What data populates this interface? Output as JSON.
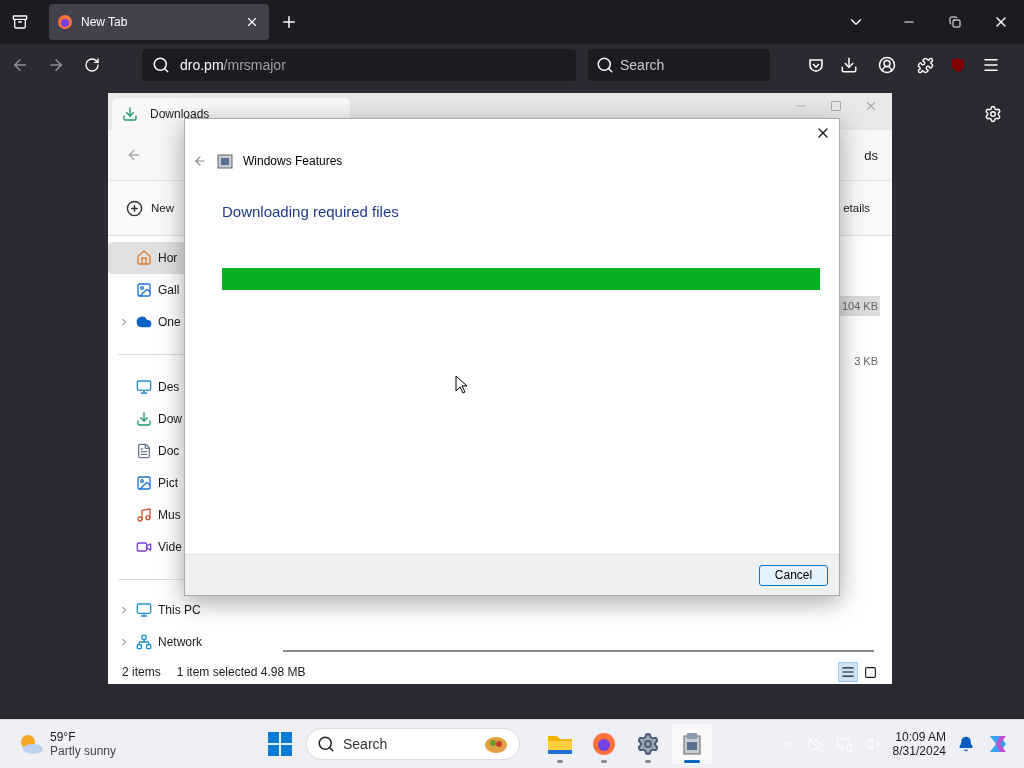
{
  "browser": {
    "tab": {
      "title": "New Tab"
    },
    "url": {
      "domain": "dro.pm",
      "path": "/mrsmajor"
    },
    "search": {
      "placeholder": "Search"
    }
  },
  "explorer": {
    "tab_title": "Downloads",
    "address_tail": "ds",
    "new_button": "New",
    "view_button": "etails",
    "nav_items": [
      {
        "label": "Hor",
        "selected": true
      },
      {
        "label": "Gall",
        "selected": false
      },
      {
        "label": "One",
        "selected": false
      }
    ],
    "library_items": [
      {
        "label": "Des",
        "selected": false
      },
      {
        "label": "Dow",
        "selected": false
      },
      {
        "label": "Doc",
        "selected": false
      },
      {
        "label": "Pict",
        "selected": false
      },
      {
        "label": "Mus",
        "selected": false
      },
      {
        "label": "Vide",
        "selected": false
      }
    ],
    "device_items": [
      {
        "label": "This PC"
      },
      {
        "label": "Network"
      }
    ],
    "sizes": [
      {
        "text": "104 KB",
        "selected": true
      },
      {
        "text": "3 KB",
        "selected": false
      }
    ],
    "status": {
      "count": "2 items",
      "selection": "1 item selected",
      "size": "4.98 MB"
    },
    "view_modes": [
      {
        "kind": "details",
        "selected": true
      },
      {
        "kind": "tiles",
        "selected": false
      }
    ]
  },
  "dialog": {
    "title": "Windows Features",
    "heading": "Downloading required files",
    "progress": {
      "level": 1
    },
    "cancel": "Cancel"
  },
  "taskbar": {
    "weather": {
      "temp": "59°F",
      "condition": "Partly sunny"
    },
    "search": {
      "placeholder": "Search"
    },
    "apps": [
      {
        "kind": "explorer",
        "selected": false
      },
      {
        "kind": "firefox",
        "selected": false
      },
      {
        "kind": "settings",
        "selected": false
      },
      {
        "kind": "features",
        "selected": true
      }
    ],
    "time": "10:09 AM",
    "date": "8/31/2024"
  }
}
